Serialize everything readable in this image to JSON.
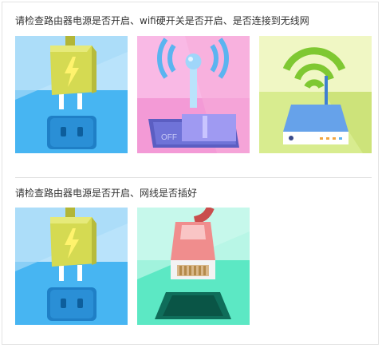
{
  "sections": [
    {
      "caption": "请检查路由器电源是否开启、wifi硬开关是否开启、是否连接到无线网",
      "illustrations": [
        {
          "name": "power-adapter-illustration",
          "icon": "power-plug-icon"
        },
        {
          "name": "wifi-switch-illustration",
          "icon": "wifi-switch-icon",
          "switch_label": "OFF"
        },
        {
          "name": "wifi-router-illustration",
          "icon": "wifi-router-icon"
        }
      ]
    },
    {
      "caption": "请检查路由器电源是否开启、网线是否插好",
      "illustrations": [
        {
          "name": "power-adapter-illustration",
          "icon": "power-plug-icon"
        },
        {
          "name": "network-cable-illustration",
          "icon": "ethernet-plug-icon"
        }
      ]
    }
  ],
  "colors": {
    "power_bg": "#4cb9f5",
    "switch_bg": "#f7a8df",
    "router_bg": "#dcee9a",
    "cable_bg": "#5ce8c4",
    "adapter_body": "#d7dc58",
    "bolt": "#fff26a"
  }
}
